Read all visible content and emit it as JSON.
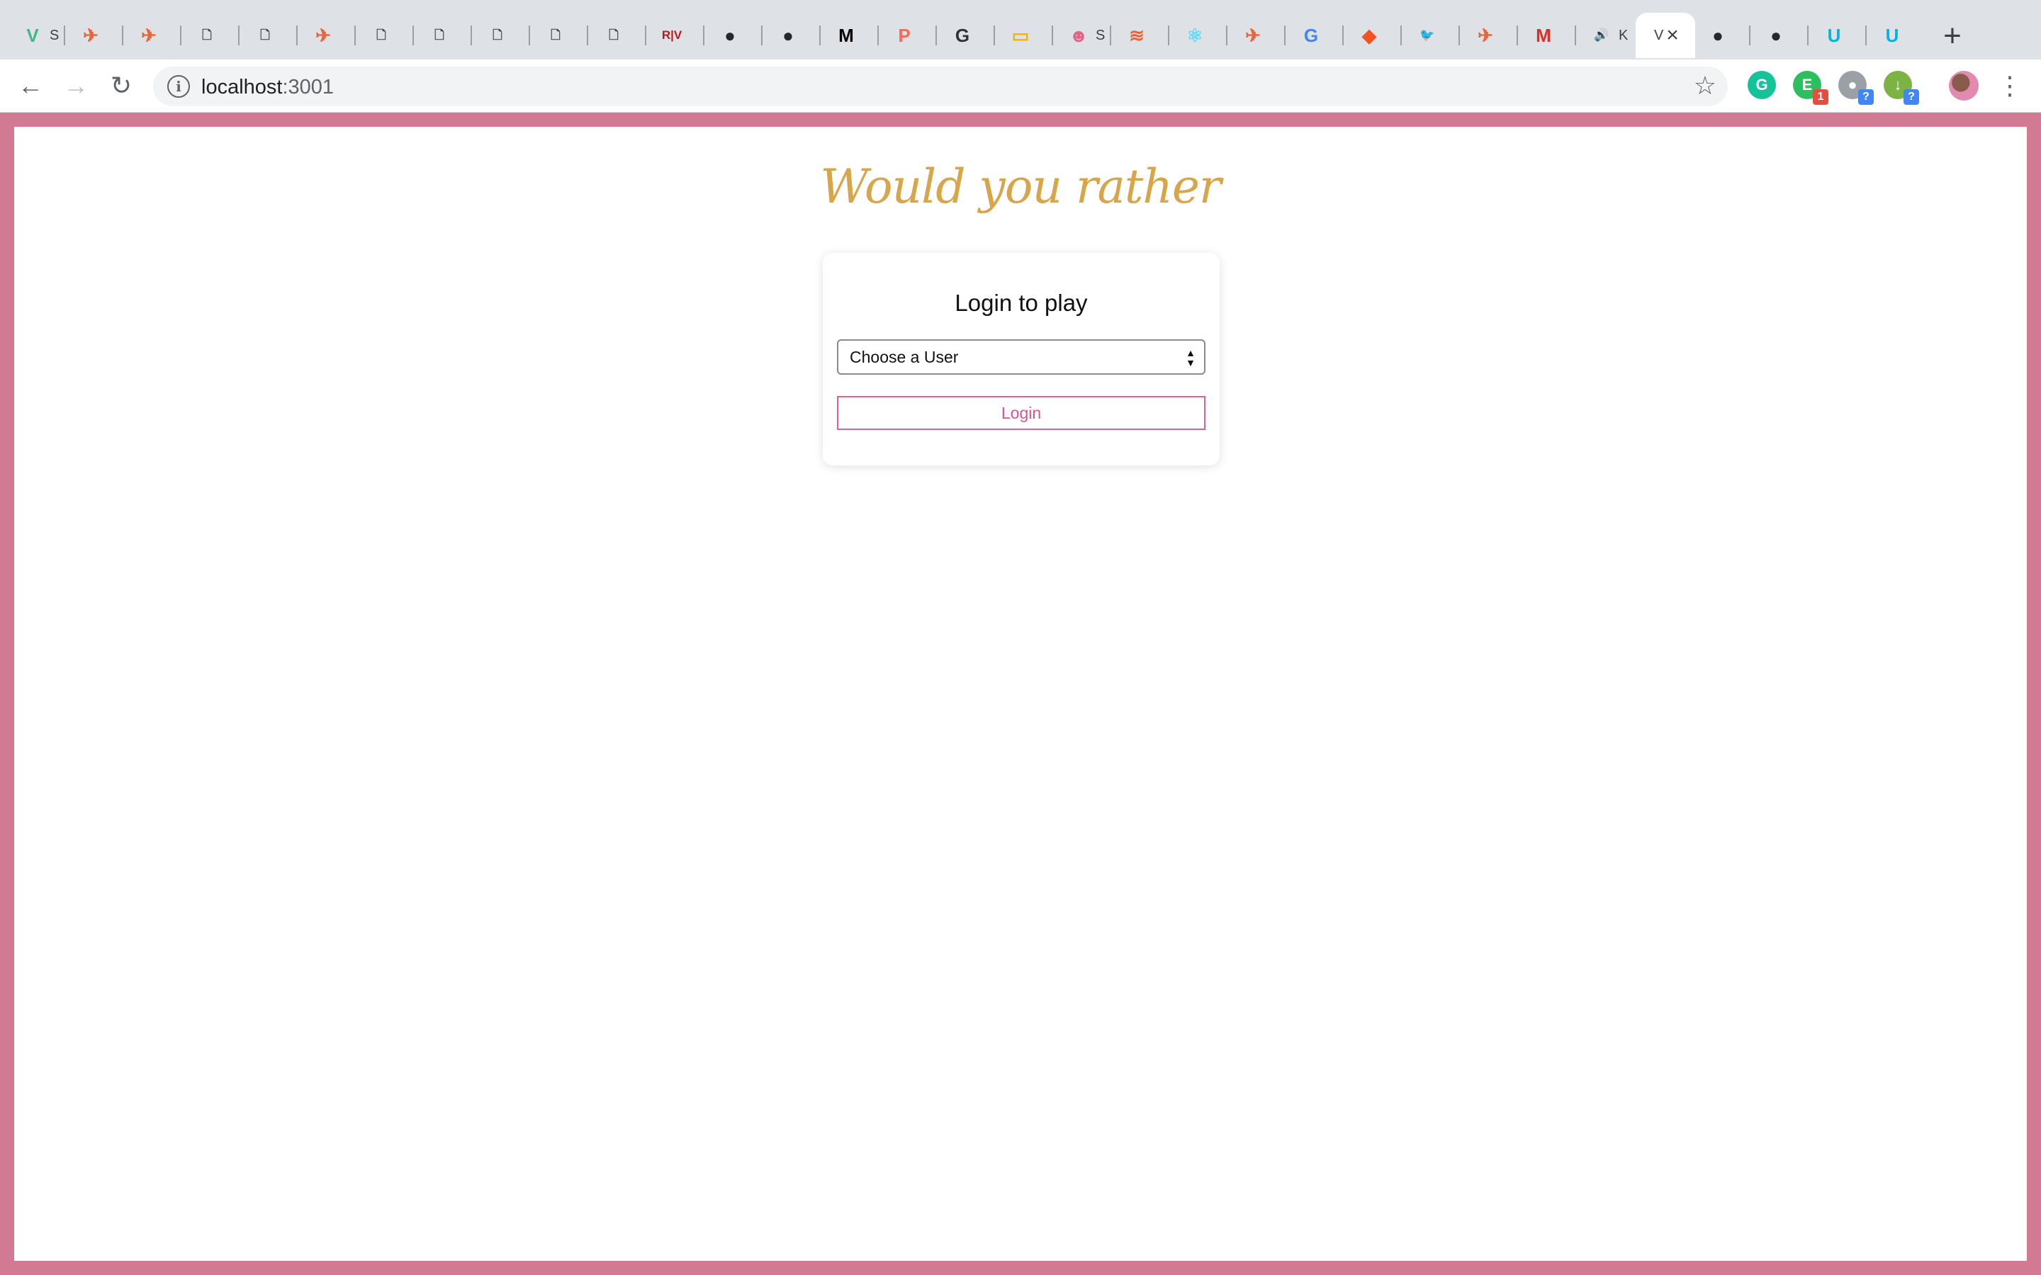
{
  "browser": {
    "tabs": [
      {
        "icon": "vue-icon",
        "glyph": "V",
        "color": "#41b883",
        "title": "S"
      },
      {
        "icon": "paper-plane-icon",
        "glyph": "✈",
        "color": "#e8643a",
        "title": ""
      },
      {
        "icon": "paper-plane-icon",
        "glyph": "✈",
        "color": "#e8643a",
        "title": ""
      },
      {
        "icon": "file-icon",
        "glyph": "🗋",
        "color": "#3c4043",
        "title": ""
      },
      {
        "icon": "file-icon",
        "glyph": "🗋",
        "color": "#3c4043",
        "title": ""
      },
      {
        "icon": "paper-plane-icon",
        "glyph": "✈",
        "color": "#e8643a",
        "title": ""
      },
      {
        "icon": "file-icon",
        "glyph": "🗋",
        "color": "#3c4043",
        "title": ""
      },
      {
        "icon": "file-icon",
        "glyph": "🗋",
        "color": "#3c4043",
        "title": ""
      },
      {
        "icon": "file-icon",
        "glyph": "🗋",
        "color": "#3c4043",
        "title": ""
      },
      {
        "icon": "file-icon",
        "glyph": "🗋",
        "color": "#3c4043",
        "title": ""
      },
      {
        "icon": "file-icon",
        "glyph": "🗋",
        "color": "#3c4043",
        "title": ""
      },
      {
        "icon": "rv-icon",
        "glyph": "R|V",
        "color": "#b71c1c",
        "title": ""
      },
      {
        "icon": "github-icon",
        "glyph": "●",
        "color": "#24292e",
        "title": ""
      },
      {
        "icon": "github-icon",
        "glyph": "●",
        "color": "#24292e",
        "title": ""
      },
      {
        "icon": "medium-icon",
        "glyph": "M",
        "color": "#000000",
        "title": ""
      },
      {
        "icon": "patreon-icon",
        "glyph": "P",
        "color": "#f96854",
        "title": ""
      },
      {
        "icon": "dev-icon",
        "glyph": "G",
        "color": "#333333",
        "title": ""
      },
      {
        "icon": "slides-icon",
        "glyph": "▭",
        "color": "#f4b400",
        "title": ""
      },
      {
        "icon": "emoji-icon",
        "glyph": "☻",
        "color": "#e06688",
        "title": "S"
      },
      {
        "icon": "stack-icon",
        "glyph": "≋",
        "color": "#e8643a",
        "title": ""
      },
      {
        "icon": "react-icon",
        "glyph": "⚛",
        "color": "#61dafb",
        "title": ""
      },
      {
        "icon": "paper-plane-icon",
        "glyph": "✈",
        "color": "#e8643a",
        "title": ""
      },
      {
        "icon": "google-icon",
        "glyph": "G",
        "color": "#4285f4",
        "title": ""
      },
      {
        "icon": "laravel-icon",
        "glyph": "◆",
        "color": "#f4511e",
        "title": ""
      },
      {
        "icon": "twitter-icon",
        "glyph": "🐦",
        "color": "#1da1f2",
        "title": ""
      },
      {
        "icon": "paper-plane-icon",
        "glyph": "✈",
        "color": "#e8643a",
        "title": ""
      },
      {
        "icon": "gmail-icon",
        "glyph": "M",
        "color": "#d93025",
        "title": ""
      },
      {
        "icon": "audio-icon",
        "glyph": "🔊",
        "color": "#3c4043",
        "title": "K"
      },
      {
        "icon": "page-icon",
        "glyph": "",
        "color": "#3c4043",
        "title": "V"
      },
      {
        "icon": "github-icon",
        "glyph": "●",
        "color": "#24292e",
        "title": ""
      },
      {
        "icon": "github-icon",
        "glyph": "●",
        "color": "#24292e",
        "title": ""
      },
      {
        "icon": "udacity-icon",
        "glyph": "U",
        "color": "#02b3e4",
        "title": ""
      },
      {
        "icon": "udacity-icon",
        "glyph": "U",
        "color": "#02b3e4",
        "title": ""
      }
    ],
    "active_tab_index": 28,
    "url_host": "localhost",
    "url_port": ":3001",
    "extensions": [
      {
        "icon": "grammarly-icon",
        "glyph": "G",
        "color": "#15c39a",
        "badge": ""
      },
      {
        "icon": "evernote-icon",
        "glyph": "E",
        "color": "#2dbe60",
        "badge": "1",
        "badge_color": "#e74c3c"
      },
      {
        "icon": "chat-icon",
        "glyph": "●",
        "color": "#9aa0a6",
        "badge": "?",
        "badge_color": "#4285f4"
      },
      {
        "icon": "download-icon",
        "glyph": "↓",
        "color": "#7cb342",
        "badge": "?",
        "badge_color": "#4285f4"
      }
    ]
  },
  "app": {
    "title": "Would you rather",
    "login": {
      "heading": "Login to play",
      "select_placeholder": "Choose a User",
      "button_label": "Login"
    },
    "colors": {
      "frame": "#d27a93",
      "title": "#d8a548",
      "button_accent": "#e0609a"
    }
  }
}
